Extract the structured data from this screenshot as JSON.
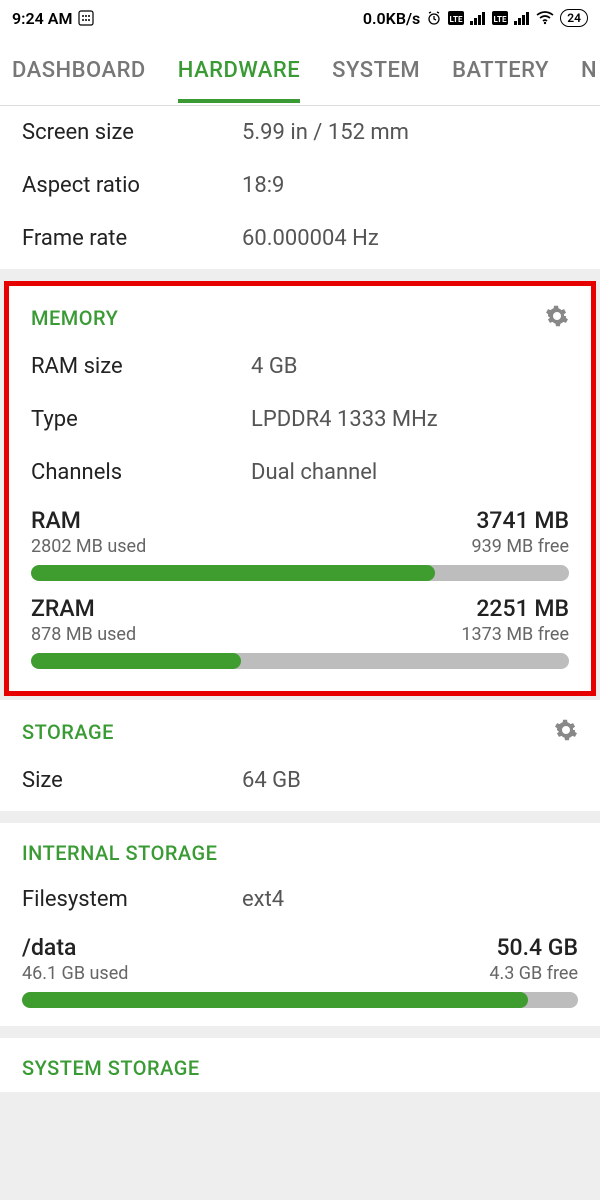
{
  "statusbar": {
    "time": "9:24 AM",
    "speed": "0.0KB/s",
    "battery": "24"
  },
  "tabs": {
    "t0": "DASHBOARD",
    "t1": "HARDWARE",
    "t2": "SYSTEM",
    "t3": "BATTERY",
    "t4": "N"
  },
  "display": {
    "screen_size_label": "Screen size",
    "screen_size_value": "5.99 in / 152 mm",
    "aspect_label": "Aspect ratio",
    "aspect_value": "18:9",
    "frame_label": "Frame rate",
    "frame_value": "60.000004 Hz"
  },
  "memory": {
    "title": "MEMORY",
    "ram_size_label": "RAM size",
    "ram_size_value": "4 GB",
    "type_label": "Type",
    "type_value": "LPDDR4 1333 MHz",
    "channels_label": "Channels",
    "channels_value": "Dual channel",
    "ram": {
      "name": "RAM",
      "total": "3741 MB",
      "used": "2802 MB used",
      "free": "939 MB free",
      "pct": 75
    },
    "zram": {
      "name": "ZRAM",
      "total": "2251 MB",
      "used": "878 MB used",
      "free": "1373 MB free",
      "pct": 39
    }
  },
  "storage": {
    "title": "STORAGE",
    "size_label": "Size",
    "size_value": "64 GB"
  },
  "internal": {
    "title": "INTERNAL STORAGE",
    "fs_label": "Filesystem",
    "fs_value": "ext4",
    "data": {
      "name": "/data",
      "total": "50.4 GB",
      "used": "46.1 GB used",
      "free": "4.3 GB free",
      "pct": 91
    }
  },
  "system_storage": {
    "title": "SYSTEM STORAGE"
  }
}
